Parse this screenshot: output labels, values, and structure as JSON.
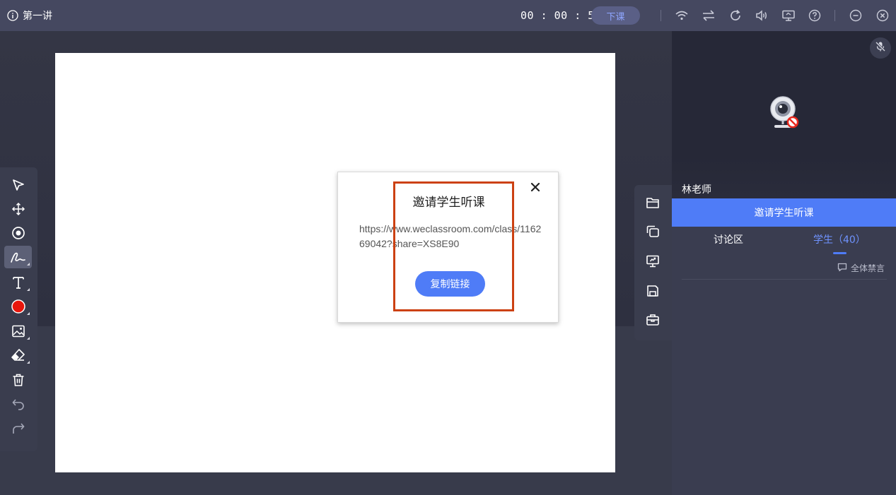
{
  "header": {
    "lesson_title": "第一讲",
    "timer": "00 : 00 : 59",
    "end_class_label": "下课"
  },
  "modal": {
    "title": "邀请学生听课",
    "link": "https://www.weclassroom.com/class/116269042?share=XS8E90",
    "copy_label": "复制链接"
  },
  "sidebar": {
    "teacher_name": "林老师",
    "invite_label": "邀请学生听课",
    "tabs": [
      {
        "label": "讨论区"
      },
      {
        "label": "学生（40）"
      }
    ],
    "mute_all_label": "全体禁言"
  },
  "colors": {
    "accent": "#4f7cf7",
    "pen_color": "#e8160c",
    "highlight": "#cc4112"
  },
  "left_tools": [
    {
      "icon": "select-arrow-icon"
    },
    {
      "icon": "move-icon"
    },
    {
      "icon": "laser-pointer-icon"
    },
    {
      "icon": "pen-icon",
      "active": true
    },
    {
      "icon": "text-icon"
    },
    {
      "icon": "color-icon"
    },
    {
      "icon": "image-icon"
    },
    {
      "icon": "eraser-icon"
    },
    {
      "icon": "trash-icon"
    },
    {
      "icon": "undo-icon"
    },
    {
      "icon": "redo-icon"
    }
  ],
  "right_tools": [
    {
      "icon": "folder-icon"
    },
    {
      "icon": "copy-pages-icon"
    },
    {
      "icon": "screen-share-icon"
    },
    {
      "icon": "save-icon"
    },
    {
      "icon": "toolbox-icon"
    }
  ]
}
